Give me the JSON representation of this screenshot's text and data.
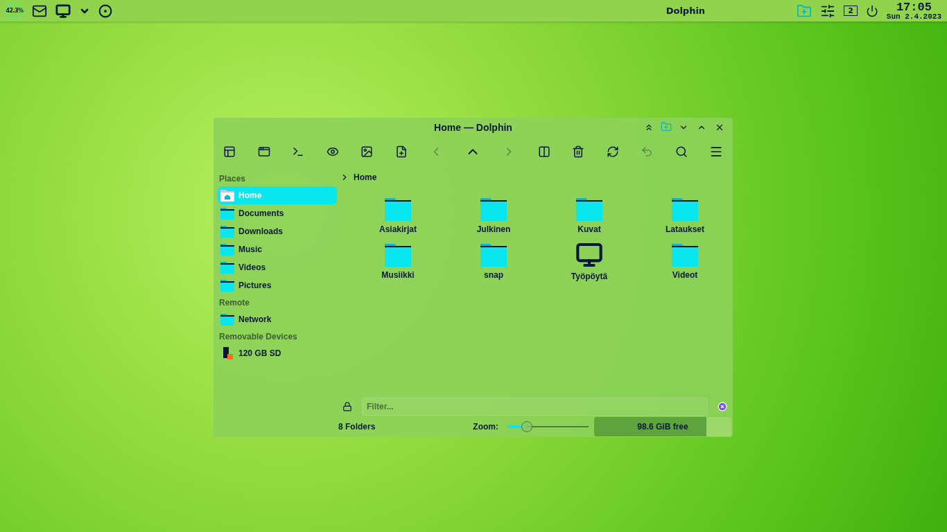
{
  "panel": {
    "cpu": "42.3%",
    "task_title": "Dolphin",
    "pager": "2",
    "clock_time": "17:05",
    "clock_date": "Sun 2.4.2023"
  },
  "window": {
    "title": "Home — Dolphin"
  },
  "sidebar": {
    "sections": [
      {
        "heading": "Places",
        "items": [
          {
            "label": "Home",
            "kind": "home",
            "selected": true
          },
          {
            "label": "Documents",
            "kind": "folder",
            "selected": false
          },
          {
            "label": "Downloads",
            "kind": "folder",
            "selected": false
          },
          {
            "label": "Music",
            "kind": "folder",
            "selected": false
          },
          {
            "label": "Videos",
            "kind": "folder",
            "selected": false
          },
          {
            "label": "Pictures",
            "kind": "folder",
            "selected": false
          }
        ]
      },
      {
        "heading": "Remote",
        "items": [
          {
            "label": "Network",
            "kind": "folder",
            "selected": false
          }
        ]
      },
      {
        "heading": "Removable Devices",
        "items": [
          {
            "label": "120 GB SD",
            "kind": "device",
            "selected": false
          }
        ]
      }
    ]
  },
  "breadcrumb": "Home",
  "files": [
    {
      "name": "Asiakirjat",
      "kind": "folder"
    },
    {
      "name": "Julkinen",
      "kind": "folder"
    },
    {
      "name": "Kuvat",
      "kind": "folder"
    },
    {
      "name": "Lataukset",
      "kind": "folder"
    },
    {
      "name": "Musiikki",
      "kind": "folder"
    },
    {
      "name": "snap",
      "kind": "folder"
    },
    {
      "name": "Työpöytä",
      "kind": "desktop"
    },
    {
      "name": "Videot",
      "kind": "folder"
    }
  ],
  "filter": {
    "placeholder": "Filter..."
  },
  "status": {
    "count": "8 Folders",
    "zoom_label": "Zoom:",
    "zoom": {
      "level": 0.23
    },
    "space": {
      "label": "98.6 GiB free",
      "level": 0.82
    }
  }
}
